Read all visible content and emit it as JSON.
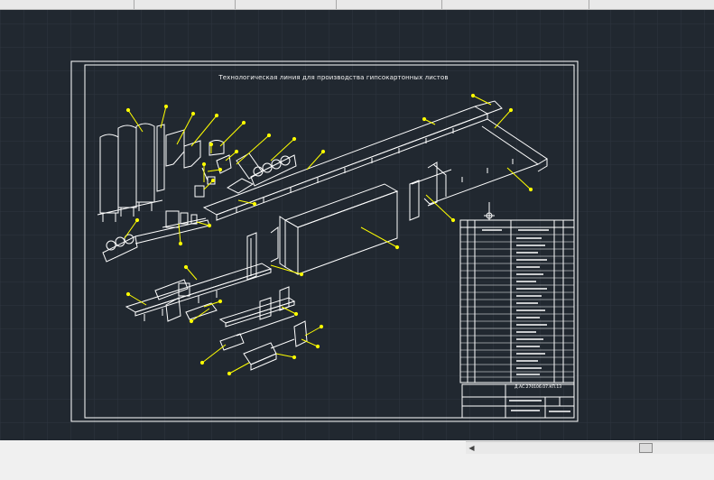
{
  "drawing": {
    "title": "Технологическая линия для производства гипсокартонных листов",
    "stamp_code": "Д.АС.270106.07.КП.13"
  },
  "colors": {
    "background": "#212830",
    "grid": "#2e3640",
    "frame": "#ffffff",
    "leader": "#ffff00",
    "chrome": "#e9e9e9"
  },
  "icons": {
    "scroll_left": "◀"
  }
}
